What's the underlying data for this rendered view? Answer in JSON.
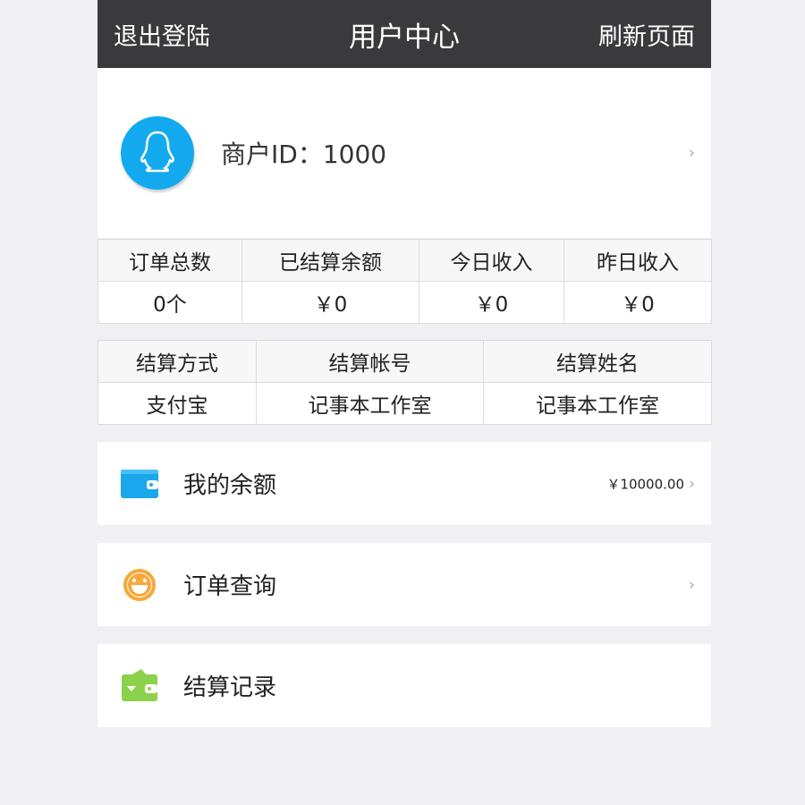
{
  "header": {
    "logout_label": "退出登陆",
    "title": "用户中心",
    "refresh_label": "刷新页面"
  },
  "profile": {
    "merchant_text": "商户ID：1000",
    "avatar_icon": "qq-penguin-icon",
    "avatar_color": "#12a9ef"
  },
  "stats": {
    "headers": [
      "订单总数",
      "已结算余额",
      "今日收入",
      "昨日收入"
    ],
    "values": [
      "0个",
      "￥0",
      "￥0",
      "￥0"
    ]
  },
  "payment": {
    "headers": [
      "结算方式",
      "结算帐号",
      "结算姓名"
    ],
    "values": [
      "支付宝",
      "记事本工作室",
      "记事本工作室"
    ]
  },
  "menu": {
    "balance": {
      "label": "我的余额",
      "value": "￥10000.00",
      "icon": "wallet-icon",
      "color": "#1aa7ec"
    },
    "orders": {
      "label": "订单查询",
      "icon": "smiley-icon",
      "color": "#f7a838"
    },
    "settlement": {
      "label": "结算记录",
      "icon": "green-wallet-icon",
      "color": "#8cd14b"
    }
  },
  "chevron": "›"
}
